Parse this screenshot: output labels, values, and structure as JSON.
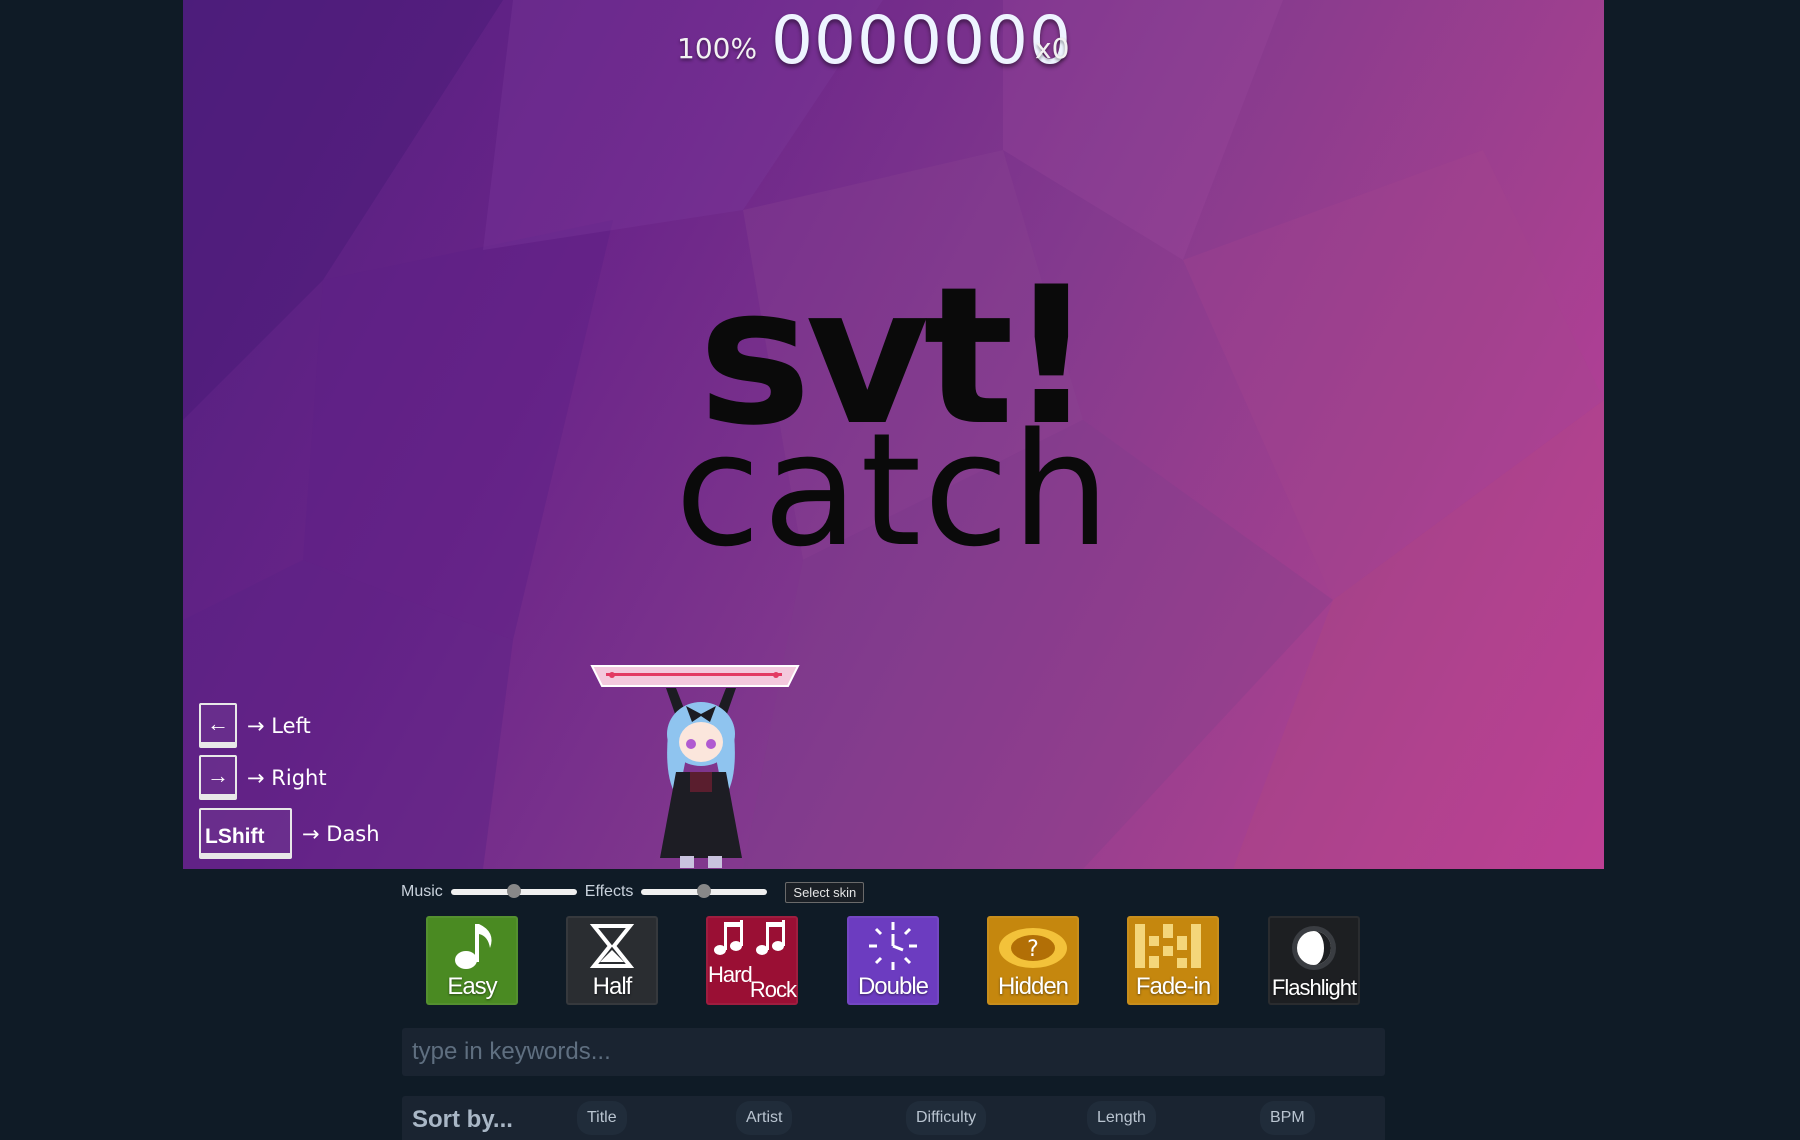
{
  "hud": {
    "accuracy": "100%",
    "score": "0000000",
    "combo": "x0"
  },
  "logo": {
    "main": "svt!",
    "sub": "catch"
  },
  "key_hints": [
    {
      "key": "←",
      "action": "→ Left"
    },
    {
      "key": "→",
      "action": "→ Right"
    },
    {
      "key": "LShift",
      "action": "→ Dash"
    }
  ],
  "volume": {
    "music_label": "Music",
    "music_level": 0.5,
    "effects_label": "Effects",
    "effects_level": 0.5,
    "skin_button": "Select skin"
  },
  "mods": [
    {
      "name": "Easy",
      "color": "#4a8a22"
    },
    {
      "name": "Half",
      "color": "#2a2d31"
    },
    {
      "name": "Hard Rock",
      "line1": "Hard",
      "line2": "Rock",
      "color": "#9a0f34"
    },
    {
      "name": "Double",
      "color": "#6c3cc0"
    },
    {
      "name": "Hidden",
      "color": "#c5870e"
    },
    {
      "name": "Fade-in",
      "color": "#c5870e"
    },
    {
      "name": "Flashlight",
      "color": "#1d1f22"
    }
  ],
  "search": {
    "placeholder": "type in keywords..."
  },
  "sort": {
    "title": "Sort by...",
    "options": [
      "Title",
      "Artist",
      "Difficulty",
      "Length",
      "BPM"
    ]
  }
}
